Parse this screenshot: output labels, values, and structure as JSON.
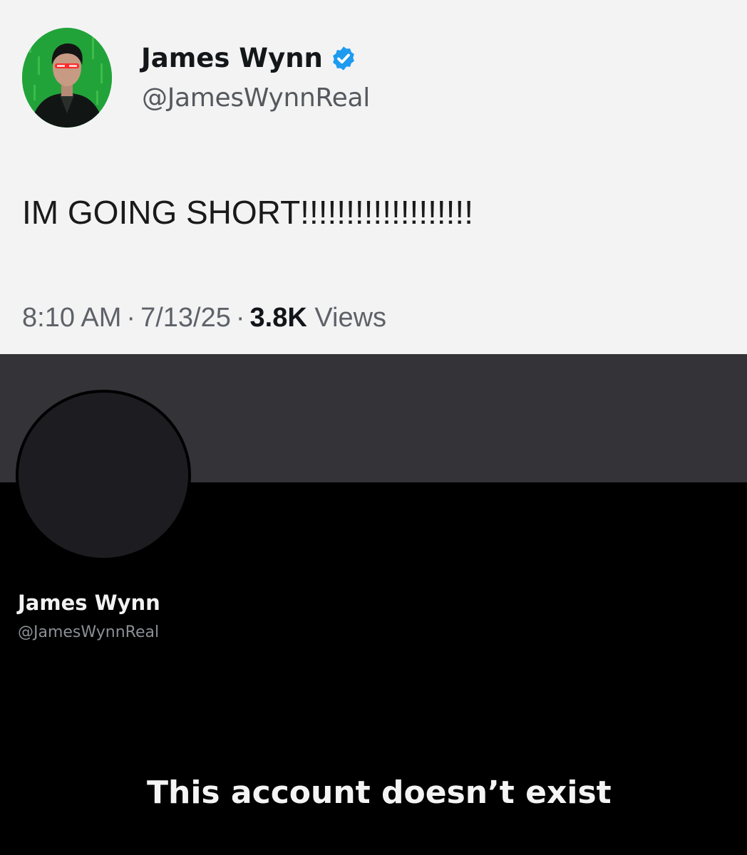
{
  "tweet": {
    "author_name": "James Wynn",
    "author_handle": "@JamesWynnReal",
    "verified": true,
    "verified_color": "#1d9bf0",
    "text": "IM GOING SHORT!!!!!!!!!!!!!!!!!!!",
    "time": "8:10 AM",
    "date": "7/13/25",
    "views_count": "3.8K",
    "views_label": "Views",
    "separator": "·"
  },
  "profile": {
    "name": "James Wynn",
    "handle": "@JamesWynnReal",
    "status_message": "This account doesn’t exist"
  },
  "colors": {
    "tweet_background": "#f3f3f4",
    "profile_background": "#000000",
    "banner": "#333338",
    "avatar_placeholder": "#1d1c21"
  }
}
